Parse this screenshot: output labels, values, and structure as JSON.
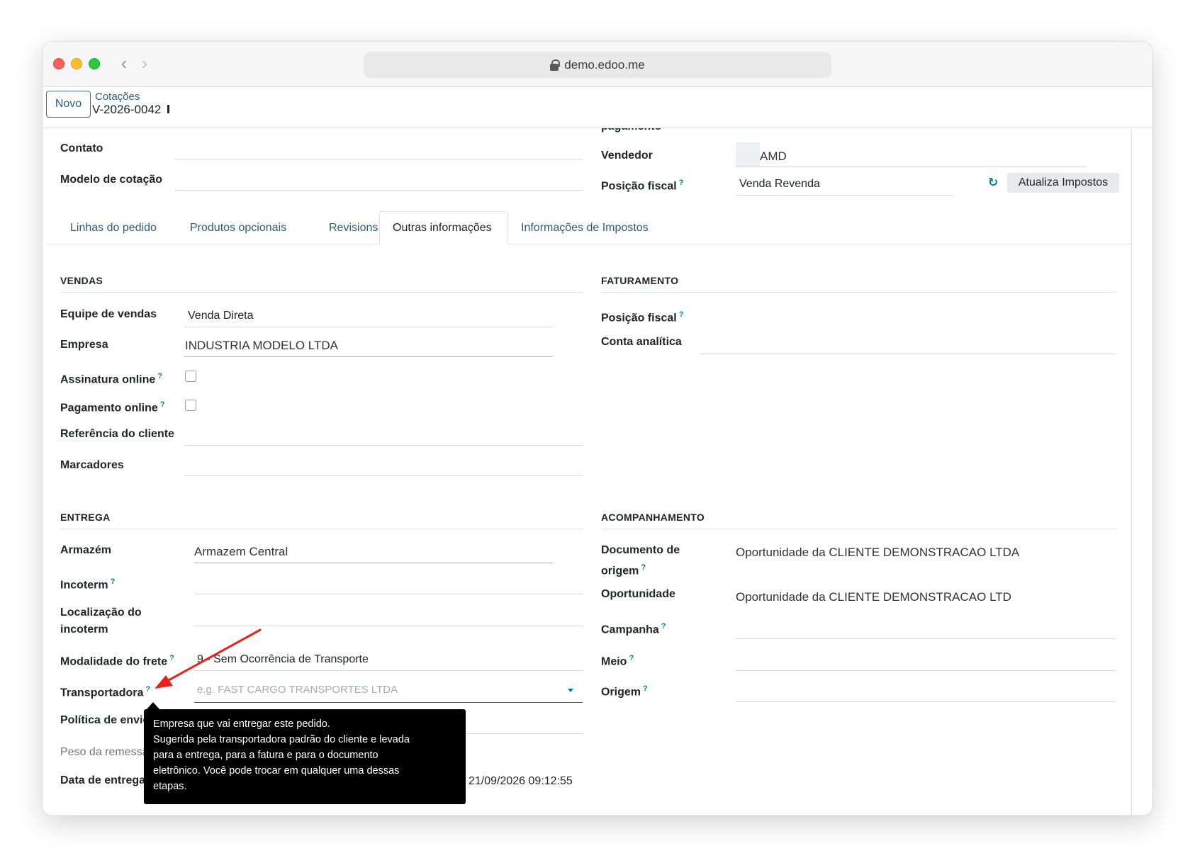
{
  "browser": {
    "url": "demo.edoo.me"
  },
  "control_panel": {
    "new_button": "Novo",
    "breadcrumb_parent": "Cotações",
    "breadcrumb_current": "V-2026-0042"
  },
  "header_fields": {
    "partial_label": "pagamento",
    "contato_label": "Contato",
    "modelo_label": "Modelo de cotação",
    "vendedor_label": "Vendedor",
    "vendedor_value": "AMD",
    "posicao_fiscal_label": "Posição fiscal",
    "posicao_fiscal_value": "Venda Revenda",
    "update_taxes_button": "Atualiza Impostos"
  },
  "tabs": [
    {
      "label": "Linhas do pedido",
      "active": false
    },
    {
      "label": "Produtos opcionais",
      "active": false
    },
    {
      "label": "Revisions",
      "active": false
    },
    {
      "label": "Outras informações",
      "active": true
    },
    {
      "label": "Informações de Impostos",
      "active": false
    }
  ],
  "vendas": {
    "title": "VENDAS",
    "equipe_label": "Equipe de vendas",
    "equipe_value": "Venda Direta",
    "empresa_label": "Empresa",
    "empresa_value": "INDUSTRIA MODELO LTDA",
    "assinatura_label": "Assinatura online",
    "pagamento_label": "Pagamento online",
    "referencia_label": "Referência do cliente",
    "marcadores_label": "Marcadores"
  },
  "faturamento": {
    "title": "FATURAMENTO",
    "posicao_fiscal_label": "Posição fiscal",
    "conta_analitica_label": "Conta analítica"
  },
  "entrega": {
    "title": "ENTREGA",
    "armazem_label": "Armazém",
    "armazem_value": "Armazem Central",
    "incoterm_label": "Incoterm",
    "localizacao_label_1": "Localização do",
    "localizacao_label_2": "incoterm",
    "modalidade_label": "Modalidade do frete",
    "modalidade_value": "9 - Sem Ocorrência de Transporte",
    "transportadora_label": "Transportadora",
    "transportadora_placeholder": "e.g. FAST CARGO TRANSPORTES LTDA",
    "politica_label": "Política de envio",
    "peso_label": "Peso da remessa",
    "data_entrega_label": "Data de entrega",
    "data_entrega_value": "21/09/2026 09:12:55"
  },
  "acompanhamento": {
    "title": "ACOMPANHAMENTO",
    "documento_label_1": "Documento de",
    "documento_label_2": "origem",
    "documento_value": "Oportunidade da CLIENTE DEMONSTRACAO LTDA",
    "oportunidade_label": "Oportunidade",
    "oportunidade_value": "Oportunidade da CLIENTE DEMONSTRACAO LTD",
    "campanha_label": "Campanha",
    "meio_label": "Meio",
    "origem_label": "Origem"
  },
  "tooltip": {
    "lines": [
      "Empresa que vai entregar este pedido.",
      "Sugerida pela transportadora padrão do cliente e levada",
      "para a entrega, para a fatura e para o documento",
      "eletrônico. Você pode trocar em qualquer uma dessas",
      "etapas."
    ]
  },
  "help_marker": "?",
  "colors": {
    "link": "#285e7e",
    "help": "#017e84",
    "annotation_arrow": "#e8231e",
    "tooltip_bg": "#000000"
  }
}
